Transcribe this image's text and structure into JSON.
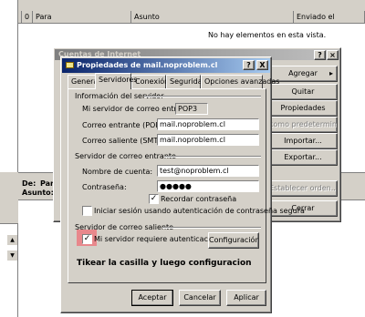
{
  "background": {
    "columns": [
      "!",
      "!",
      "0",
      "Para",
      "Asunto",
      "Enviado el"
    ],
    "empty_message": "No hay elementos en esta vista.",
    "preview_de_label": "De:",
    "preview_de_value": "Para",
    "preview_asunto_label": "Asunto:"
  },
  "accounts_window": {
    "title": "Cuentas de Internet",
    "buttons": {
      "add": "Agregar",
      "remove": "Quitar",
      "properties": "Propiedades",
      "set_default": "como predeterminada",
      "import": "Importar...",
      "export": "Exportar...",
      "set_order": "Establecer orden...",
      "close": "Cerrar"
    }
  },
  "dialog": {
    "title": "Propiedades de mail.noproblem.cl",
    "help_btn": "?",
    "close_btn": "X",
    "tabs": [
      "General",
      "Servidores",
      "Conexión",
      "Seguridad",
      "Opciones avanzadas"
    ],
    "server_info_header": "Información del servidor",
    "incoming_type_label": "Mi servidor de correo entrante es",
    "incoming_type_value": "POP3",
    "incoming_label": "Correo entrante (POP3):",
    "incoming_value": "mail.noproblem.cl",
    "outgoing_label": "Correo saliente (SMTP):",
    "outgoing_value": "mail.noproblem.cl",
    "incoming_server_header": "Servidor de correo entrante",
    "account_label": "Nombre de cuenta:",
    "account_value": "test@noproblem.cl",
    "password_label": "Contraseña:",
    "password_value": "●●●●●",
    "remember_password": "Recordar contraseña",
    "spa_label": "Iniciar sesión usando autenticación de contraseña segura",
    "outgoing_server_header": "Servidor de correo saliente",
    "auth_required": "Mi servidor requiere autenticación",
    "config_button": "Configuración...",
    "instruction": "Tikear la casilla y luego configuracion",
    "ok": "Aceptar",
    "cancel": "Cancelar",
    "apply": "Aplicar",
    "checkbox_states": {
      "remember_password": true,
      "spa": false,
      "auth_required": true
    },
    "highlight_color": "#e8888c"
  }
}
